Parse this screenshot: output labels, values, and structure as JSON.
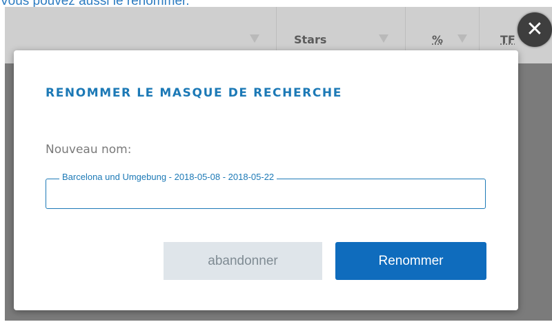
{
  "top_caption": "Vous pouvez aussi le renommer.",
  "table_header": {
    "columns": [
      {
        "label": ""
      },
      {
        "label": "Stars"
      },
      {
        "label": "%"
      },
      {
        "label": "TF"
      }
    ]
  },
  "close_button": {
    "glyph": "✕",
    "icon": "close-icon"
  },
  "dialog": {
    "title": "RENOMMER LE MASQUE DE RECHERCHE",
    "field_label": "Nouveau nom:",
    "field_legend": "Barcelona und Umgebung - 2018-05-08 - 2018-05-22",
    "field_value": "",
    "cancel_label": "abandonner",
    "confirm_label": "Renommer"
  },
  "colors": {
    "accent": "#1c79b6",
    "primary_button": "#0f6cbd",
    "secondary_button": "#dfe5ea",
    "overlay": "#7b7b7b"
  }
}
